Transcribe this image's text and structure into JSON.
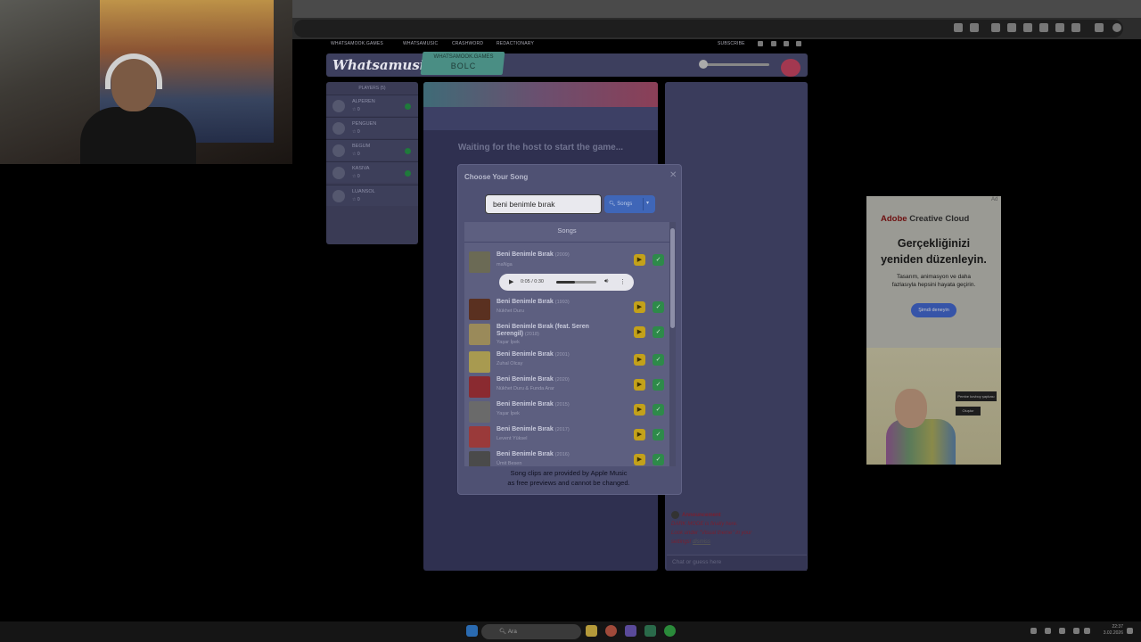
{
  "site": {
    "nav": [
      "WHATSAMOOK.GAMES",
      "WHATSAMUSIC",
      "CRASHWORD",
      "REDACTIONARY"
    ],
    "subscribe": "SUBSCRIBE",
    "logo": "Whatsamusic",
    "room_domain": "WHATSAMOOK.GAMES",
    "room_code": "BOLC"
  },
  "players": {
    "title": "PLAYERS (5)",
    "list": [
      {
        "name": "ALPEREN",
        "score": "☆ 0",
        "ready": true
      },
      {
        "name": "PENGUEN",
        "score": "☆ 0",
        "ready": false
      },
      {
        "name": "BEGUM",
        "score": "☆ 0",
        "ready": true
      },
      {
        "name": "KASIVA",
        "score": "☆ 0",
        "ready": true
      },
      {
        "name": "LUANSOL",
        "score": "☆ 0",
        "ready": false
      }
    ]
  },
  "stage": {
    "waiting": "Waiting for the host to start the game..."
  },
  "chat": {
    "announce_title": "Announcement",
    "announce_l1": "DARK MODE is finally here.",
    "announce_l2": "Look under \"Visual theme\" in your",
    "announce_l3": "settings!",
    "announce_link": "dismiss",
    "placeholder": "Chat or guess here"
  },
  "modal": {
    "title": "Choose Your Song",
    "close": "✕",
    "search_value": "beni benimle bırak",
    "search_button": "Songs",
    "list_header": "Songs",
    "note_line1": "Song clips are provided by Apple Music",
    "note_line2": "as free previews and cannot be changed.",
    "audio_time": "0:05 / 0:30",
    "songs": [
      {
        "title": "Beni Benimle Bırak",
        "year": "(2009)",
        "artist": "maNga",
        "art": "#6b6a55"
      },
      {
        "title": "Beni Benimle Bırak",
        "year": "(1993)",
        "artist": "Nükhet Duru",
        "art": "#5a3020"
      },
      {
        "title": "Beni Benimle Bırak (feat. Seren",
        "title2": "Serengil)",
        "year": "(2018)",
        "artist": "Yaşar İpek",
        "art": "#9a8a5a"
      },
      {
        "title": "Beni Benimle Bırak",
        "year": "(2001)",
        "artist": "Zuhal Olcay",
        "art": "#a89a50"
      },
      {
        "title": "Beni Benimle Bırak",
        "year": "(2020)",
        "artist": "Nükhet Duru & Funda Arar",
        "art": "#8a2a30"
      },
      {
        "title": "Beni Benimle Bırak",
        "year": "(2015)",
        "artist": "Yaşar İpek",
        "art": "#6a6a6a"
      },
      {
        "title": "Beni Benimle Bırak",
        "year": "(2017)",
        "artist": "Levent Yüksel",
        "art": "#9a3a3a"
      },
      {
        "title": "Beni Benimle Bırak",
        "year": "(2016)",
        "artist": "Ümit Besen",
        "art": "#4a4a4a"
      }
    ]
  },
  "ad": {
    "brand_prefix": "Adobe",
    "brand": "Creative Cloud",
    "headline1": "Gerçekliğinizi",
    "headline2": "yeniden düzenleyin.",
    "sub1": "Tasarım, animasyon ve daha",
    "sub2": "fazlasıyla hepsini hayata geçirin.",
    "cta": "Şimdi deneyin",
    "badge1": "Pembe kovboy şapkası",
    "badge2": "Oluştur",
    "tag": "Ad"
  },
  "taskbar": {
    "search": "Ara",
    "time": "22:37",
    "date": "3.02.2026"
  },
  "colors": {
    "accent_blue": "#3f66b8",
    "play_yellow": "#c3a11a",
    "pick_green": "#2e8a4a",
    "announce_red": "#7a1f2f"
  }
}
